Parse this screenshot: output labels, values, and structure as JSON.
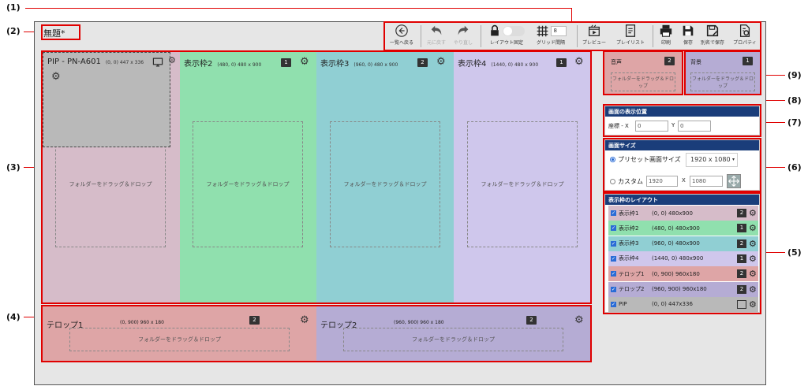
{
  "callouts": [
    "(1)",
    "(2)",
    "(3)",
    "(4)",
    "(5)",
    "(6)",
    "(7)",
    "(8)",
    "(9)"
  ],
  "title": "無題*",
  "toolbar": {
    "back": "一覧へ戻る",
    "undo": "元に戻す",
    "redo": "やり直し",
    "lock": "レイアウト固定",
    "grid": "グリッド間隔",
    "grid_value": "8",
    "preview": "プレビュー",
    "playlist": "プレイリスト",
    "print": "印刷",
    "save": "保存",
    "save_as": "別名で保存",
    "properties": "プロパティ"
  },
  "frames": [
    {
      "name": "表示枠2",
      "coords": "(480, 0) 480 x 900",
      "badge": "1",
      "color": "#90e0ae"
    },
    {
      "name": "表示枠3",
      "coords": "(960, 0) 480 x 900",
      "badge": "2",
      "color": "#90cfd3"
    },
    {
      "name": "表示枠4",
      "coords": "(1440, 0) 480 x 900",
      "badge": "1",
      "color": "#cfc7ec"
    }
  ],
  "frame1": {
    "color": "#d6bcc9"
  },
  "pip": {
    "name": "PIP - PN-A601",
    "coords": "(0, 0) 447 x 336",
    "color": "#b9b9b9"
  },
  "drop_text": "フォルダーをドラッグ＆ドロップ",
  "telops": [
    {
      "name": "テロップ1",
      "coords": "(0, 900) 960 x 180",
      "badge": "2",
      "color": "#dea5a6"
    },
    {
      "name": "テロップ2",
      "coords": "(960, 900) 960 x 180",
      "badge": "2",
      "color": "#b5acd4"
    }
  ],
  "audio": {
    "label": "音声",
    "badge": "2",
    "drop": "フォルダーをドラッグ＆ドロップ",
    "color": "#dea5a6"
  },
  "background": {
    "label": "背景",
    "badge": "1",
    "drop": "フォルダーをドラッグ＆ドロップ",
    "color": "#b5acd4"
  },
  "position": {
    "header": "画面の表示位置",
    "label": "座標 - X",
    "x": "0",
    "y_label": "Y",
    "y": "0"
  },
  "screen_size": {
    "header": "画面サイズ",
    "preset_label": "プリセット画面サイズ",
    "preset_value": "1920 x 1080",
    "custom_label": "カスタム",
    "w": "1920",
    "x_label": "X",
    "h": "1080"
  },
  "layout_list": {
    "header": "表示枠のレイアウト",
    "rows": [
      {
        "name": "表示枠1",
        "coords": "(0, 0) 480x900",
        "badge": "2",
        "color": "#d6bcc9"
      },
      {
        "name": "表示枠2",
        "coords": "(480, 0) 480x900",
        "badge": "1",
        "color": "#90e0ae"
      },
      {
        "name": "表示枠3",
        "coords": "(960, 0) 480x900",
        "badge": "2",
        "color": "#90cfd3"
      },
      {
        "name": "表示枠4",
        "coords": "(1440, 0) 480x900",
        "badge": "1",
        "color": "#cfc7ec"
      },
      {
        "name": "テロップ1",
        "coords": "(0, 900) 960x180",
        "badge": "2",
        "color": "#dea5a6"
      },
      {
        "name": "テロップ2",
        "coords": "(960, 900) 960x180",
        "badge": "2",
        "color": "#b5acd4"
      },
      {
        "name": "PIP",
        "coords": "(0, 0) 447x336",
        "badge": "",
        "color": "#b9b9b9"
      }
    ]
  }
}
